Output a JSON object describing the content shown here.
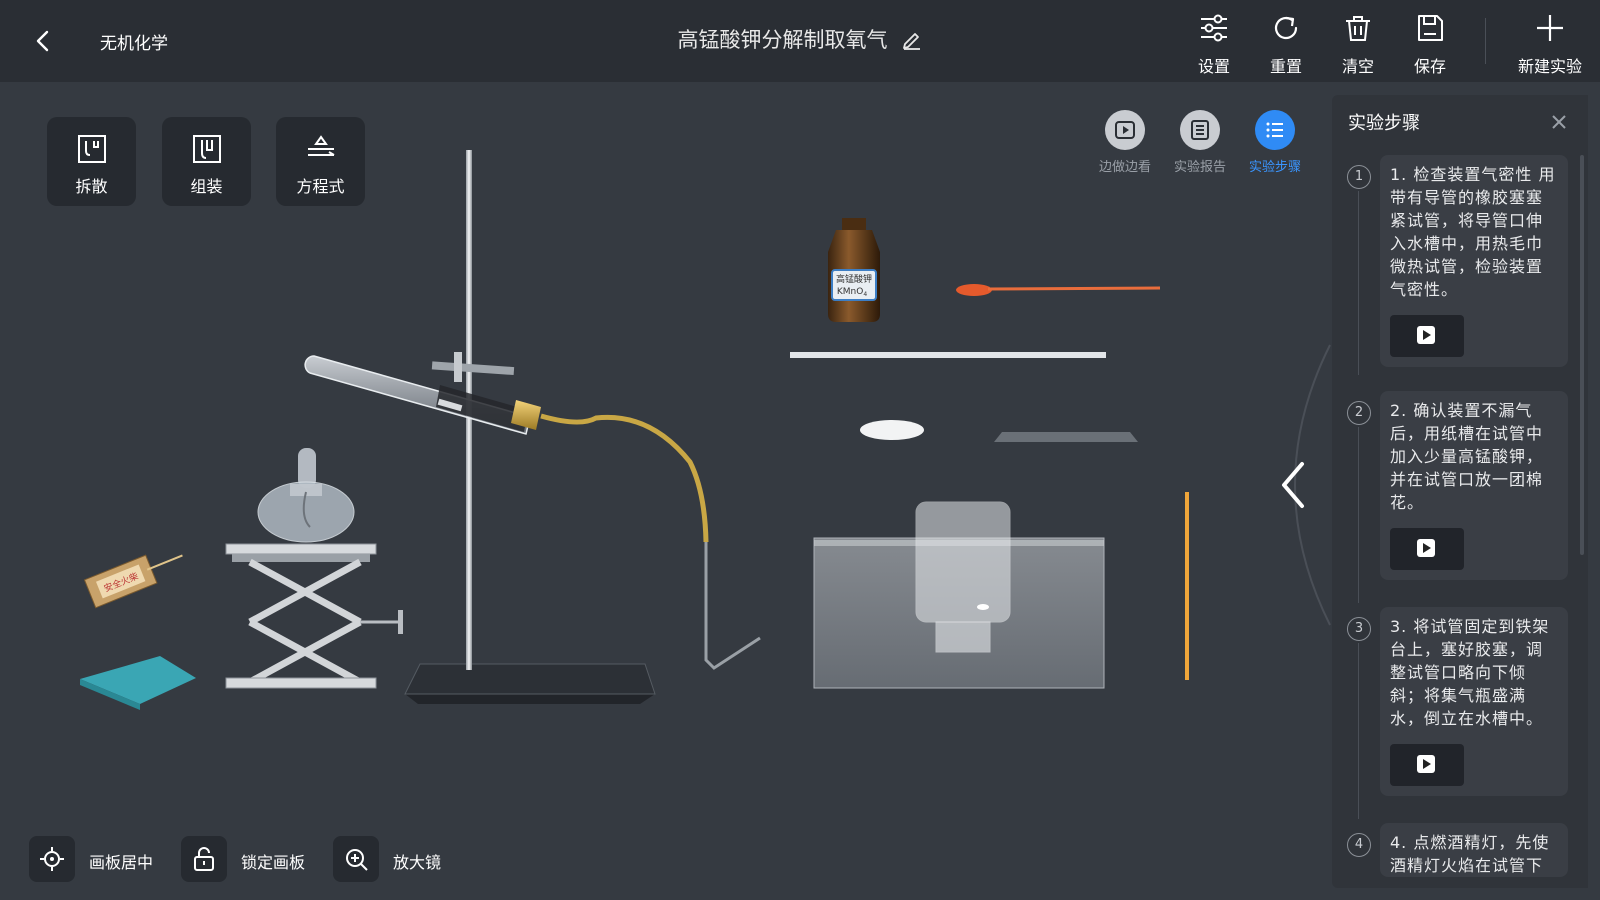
{
  "header": {
    "category": "无机化学",
    "title": "高锰酸钾分解制取氧气",
    "actions": [
      {
        "label": "设置",
        "icon": "settings-sliders-icon"
      },
      {
        "label": "重置",
        "icon": "reset-icon"
      },
      {
        "label": "清空",
        "icon": "trash-icon"
      },
      {
        "label": "保存",
        "icon": "save-icon"
      },
      {
        "label": "新建实验",
        "icon": "plus-icon"
      }
    ]
  },
  "tools": [
    {
      "label": "拆散",
      "icon": "disassemble-icon"
    },
    {
      "label": "组装",
      "icon": "assemble-icon"
    },
    {
      "label": "方程式",
      "icon": "equation-icon"
    }
  ],
  "views": [
    {
      "label": "边做边看",
      "icon": "play-icon",
      "active": false
    },
    {
      "label": "实验报告",
      "icon": "report-icon",
      "active": false
    },
    {
      "label": "实验步骤",
      "icon": "steps-list-icon",
      "active": true
    }
  ],
  "bottom": [
    {
      "label": "画板居中",
      "icon": "target-icon"
    },
    {
      "label": "锁定画板",
      "icon": "lock-icon"
    },
    {
      "label": "放大镜",
      "icon": "zoom-in-icon"
    }
  ],
  "apparatus": {
    "bottle_label_top": "高锰酸钾",
    "bottle_label_formula": "KMnO",
    "bottle_label_subscript": "4",
    "matchbox_label": "安全火柴"
  },
  "panel": {
    "title": "实验步骤",
    "steps": [
      {
        "num": "1",
        "text": "1. 检查装置气密性 用带有导管的橡胶塞塞紧试管，将导管口伸入水槽中，用热毛巾微热试管，检验装置气密性。"
      },
      {
        "num": "2",
        "text": "2. 确认装置不漏气后，用纸槽在试管中加入少量高锰酸钾，并在试管口放一团棉花。"
      },
      {
        "num": "3",
        "text": "3. 将试管固定到铁架台上，塞好胶塞，调整试管口略向下倾斜；将集气瓶盛满水，倒立在水槽中。"
      },
      {
        "num": "4",
        "text": "4. 点燃酒精灯，先使酒精灯火焰在试管下"
      }
    ]
  },
  "colors": {
    "background": "#353a41",
    "topbar": "#2a2e34",
    "accent": "#2f8bf5"
  }
}
